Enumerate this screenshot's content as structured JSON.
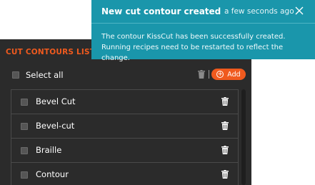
{
  "toast": {
    "title": "New cut contour created",
    "time": "a few seconds ago",
    "message": "The contour KissCut has been successfully created. Running recipes need to be restarted to reflect the change."
  },
  "panel": {
    "title": "CUT CONTOURS LIST",
    "select_all_label": "Select all",
    "add_label": "Add",
    "items": [
      {
        "label": "Bevel Cut"
      },
      {
        "label": "Bevel-cut"
      },
      {
        "label": "Braille"
      },
      {
        "label": "Contour"
      }
    ]
  },
  "colors": {
    "accent": "#f05a1e",
    "toast_bg": "#1a96ab",
    "panel_bg": "#2b2b2b"
  }
}
